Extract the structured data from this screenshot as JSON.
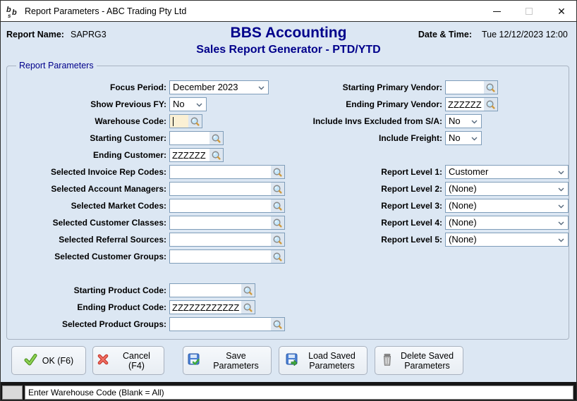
{
  "window": {
    "title": "Report Parameters - ABC Trading Pty Ltd",
    "controls": {
      "minimize": "minimize",
      "maximize": "maximize",
      "close": "close"
    }
  },
  "header": {
    "report_name_label": "Report Name:",
    "report_name_value": "SAPRG3",
    "app_title": "BBS Accounting",
    "report_title": "Sales Report Generator - PTD/YTD",
    "datetime_label": "Date & Time:",
    "datetime_value": "Tue 12/12/2023 12:00"
  },
  "form": {
    "group_title": "Report Parameters",
    "fields": {
      "focus_period": {
        "label": "Focus Period:",
        "value": "December 2023"
      },
      "show_previous_fy": {
        "label": "Show Previous FY:",
        "value": "No"
      },
      "warehouse_code": {
        "label": "Warehouse Code:",
        "value": ""
      },
      "starting_customer": {
        "label": "Starting Customer:",
        "value": ""
      },
      "ending_customer": {
        "label": "Ending Customer:",
        "value": "ZZZZZZ"
      },
      "selected_invoice_rep_codes": {
        "label": "Selected Invoice Rep Codes:",
        "value": ""
      },
      "selected_account_managers": {
        "label": "Selected Account Managers:",
        "value": ""
      },
      "selected_market_codes": {
        "label": "Selected Market Codes:",
        "value": ""
      },
      "selected_customer_classes": {
        "label": "Selected Customer Classes:",
        "value": ""
      },
      "selected_referral_sources": {
        "label": "Selected Referral Sources:",
        "value": ""
      },
      "selected_customer_groups": {
        "label": "Selected Customer Groups:",
        "value": ""
      },
      "starting_product_code": {
        "label": "Starting Product Code:",
        "value": ""
      },
      "ending_product_code": {
        "label": "Ending Product Code:",
        "value": "ZZZZZZZZZZZZ"
      },
      "selected_product_groups": {
        "label": "Selected Product Groups:",
        "value": ""
      },
      "starting_primary_vendor": {
        "label": "Starting Primary Vendor:",
        "value": ""
      },
      "ending_primary_vendor": {
        "label": "Ending Primary Vendor:",
        "value": "ZZZZZZ"
      },
      "include_invs_excluded": {
        "label": "Include Invs Excluded from S/A:",
        "value": "No"
      },
      "include_freight": {
        "label": "Include Freight:",
        "value": "No"
      },
      "report_level_1": {
        "label": "Report Level 1:",
        "value": "Customer"
      },
      "report_level_2": {
        "label": "Report Level 2:",
        "value": "(None)"
      },
      "report_level_3": {
        "label": "Report Level 3:",
        "value": "(None)"
      },
      "report_level_4": {
        "label": "Report Level 4:",
        "value": "(None)"
      },
      "report_level_5": {
        "label": "Report Level 5:",
        "value": "(None)"
      }
    }
  },
  "buttons": {
    "ok": "OK (F6)",
    "cancel": "Cancel (F4)",
    "save": "Save Parameters",
    "load": "Load Saved Parameters",
    "delete": "Delete Saved Parameters"
  },
  "status": {
    "message": "Enter Warehouse Code (Blank = All)"
  },
  "colors": {
    "accent_navy": "#00008B",
    "window_bg": "#DCE7F3",
    "focused_field_cream": "#FBF0D4",
    "field_border": "#7F9DB9",
    "ok_green": "#6DB33F",
    "cancel_red": "#E2574C",
    "statusbar_dark": "#161616"
  }
}
